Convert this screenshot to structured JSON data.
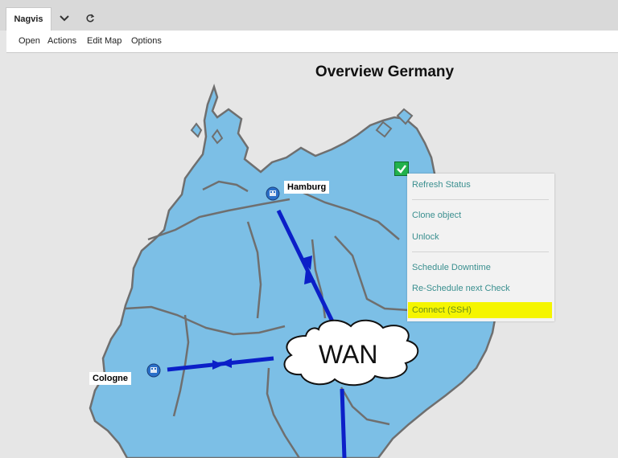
{
  "tabs": {
    "active_label": "Nagvis"
  },
  "menubar": {
    "items": [
      "Open",
      "Actions",
      "Edit Map",
      "Options"
    ]
  },
  "map": {
    "title": "Overview Germany",
    "cities": {
      "hamburg": "Hamburg",
      "cologne": "Cologne"
    },
    "wan_label": "WAN",
    "colors": {
      "land": "#7cbfe6",
      "border": "#6f6f6f",
      "link": "#0b1fc8",
      "highlight": "#f5f500"
    }
  },
  "context_menu": {
    "items": [
      "Refresh Status",
      "Clone object",
      "Unlock",
      "Schedule Downtime",
      "Re-Schedule next Check",
      "Connect (SSH)"
    ],
    "highlighted": "Connect (SSH)"
  },
  "icons": [
    "dropdown-chevron-icon",
    "refresh-icon",
    "status-ok-icon",
    "host-icon"
  ]
}
